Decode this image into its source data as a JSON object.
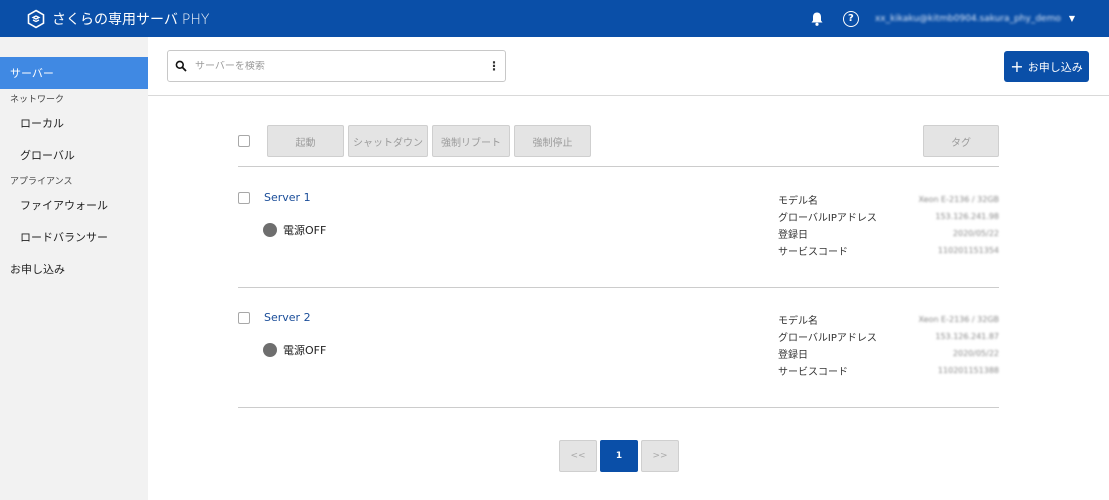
{
  "header": {
    "brand": "さくらの専用サーバ",
    "brand_suffix": "PHY",
    "help_label": "?",
    "user_email": "xx_kikaku@kitmb0904.sakura_phy_demo",
    "user_caret": "▼"
  },
  "sidebar": {
    "servers": "サーバー",
    "network_heading": "ネットワーク",
    "local": "ローカル",
    "global": "グローバル",
    "appliance_heading": "アプライアンス",
    "firewall": "ファイアウォール",
    "load_balancer": "ロードバランサー",
    "apply": "お申し込み"
  },
  "toolbar": {
    "search_placeholder": "サーバーを検索",
    "menu_glyph": "⋮",
    "apply_plus": "+",
    "apply_label": "お申し込み"
  },
  "actions": {
    "start": "起動",
    "shutdown": "シャットダウン",
    "force_reboot": "強制リブート",
    "force_stop": "強制停止",
    "tag": "タグ"
  },
  "servers": [
    {
      "name": "Server 1",
      "power": "電源OFF",
      "specs": [
        {
          "label": "モデル名",
          "value": "Xeon E-2136 / 32GB"
        },
        {
          "label": "グローバルIPアドレス",
          "value": "153.126.241.98"
        },
        {
          "label": "登録日",
          "value": "2020/05/22"
        },
        {
          "label": "サービスコード",
          "value": "110201151354"
        }
      ]
    },
    {
      "name": "Server 2",
      "power": "電源OFF",
      "specs": [
        {
          "label": "モデル名",
          "value": "Xeon E-2136 / 32GB"
        },
        {
          "label": "グローバルIPアドレス",
          "value": "153.126.241.87"
        },
        {
          "label": "登録日",
          "value": "2020/05/22"
        },
        {
          "label": "サービスコード",
          "value": "110201151388"
        }
      ]
    }
  ],
  "pagination": {
    "prev": "<<",
    "current": "1",
    "next": ">>"
  }
}
